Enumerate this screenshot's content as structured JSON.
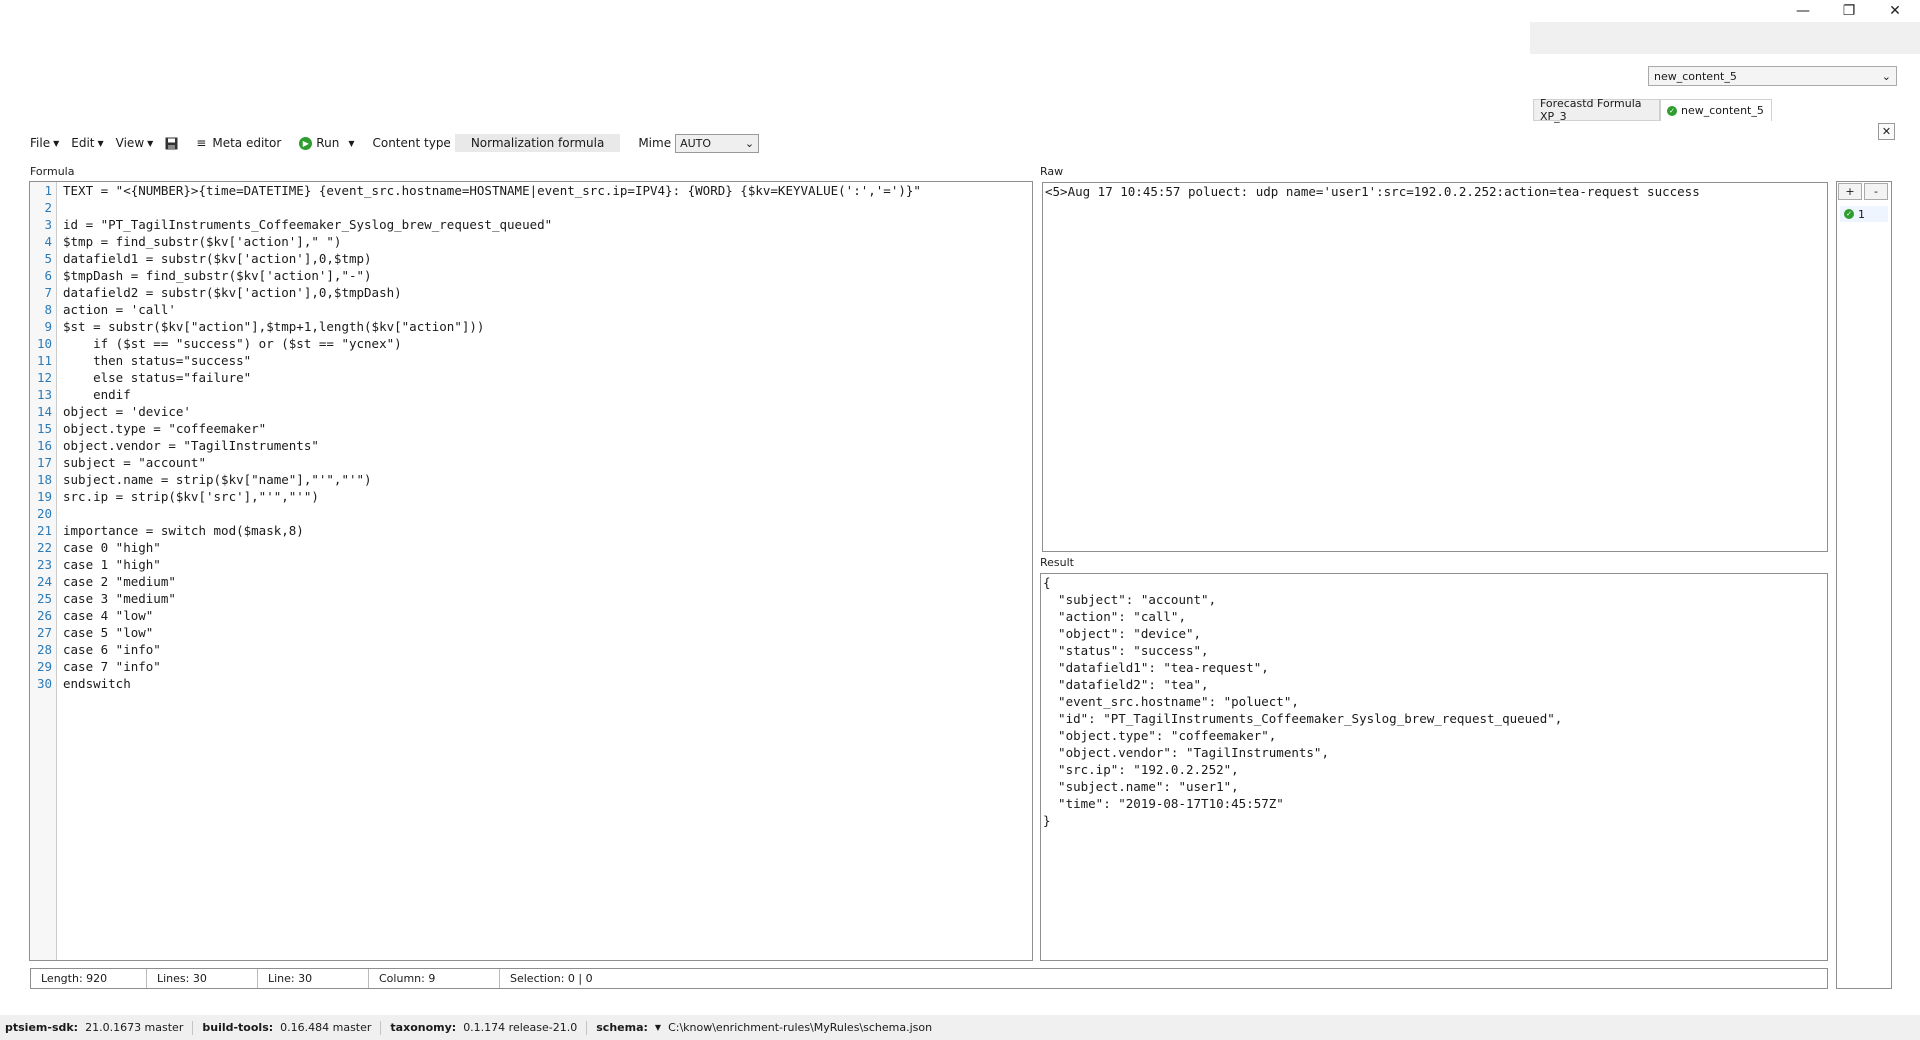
{
  "window": {
    "minimize": "—",
    "restore": "❐",
    "close": "✕"
  },
  "content_selector": {
    "value": "new_content_5"
  },
  "tabs": [
    {
      "label": "Forecastd Formula XP_3",
      "active": false
    },
    {
      "label": "new_content_5",
      "active": true
    }
  ],
  "toolbar": {
    "file": "File",
    "edit": "Edit",
    "view": "View",
    "meta_editor": "Meta editor",
    "run": "Run",
    "content_type_label": "Content type",
    "content_type_value": "Normalization formula",
    "mime_label": "Mime",
    "mime_value": "AUTO"
  },
  "labels": {
    "formula": "Formula",
    "raw": "Raw",
    "result": "Result"
  },
  "formula_lines": [
    "TEXT = \"<{NUMBER}>{time=DATETIME} {event_src.hostname=HOSTNAME|event_src.ip=IPV4}: {WORD} {$kv=KEYVALUE(':','=')}\"",
    "",
    "id = \"PT_TagilInstruments_Coffeemaker_Syslog_brew_request_queued\"",
    "$tmp = find_substr($kv['action'],\" \")",
    "datafield1 = substr($kv['action'],0,$tmp)",
    "$tmpDash = find_substr($kv['action'],\"-\")",
    "datafield2 = substr($kv['action'],0,$tmpDash)",
    "action = 'call'",
    "$st = substr($kv[\"action\"],$tmp+1,length($kv[\"action\"]))",
    "    if ($st == \"success\") or ($st == \"ycnex\")",
    "    then status=\"success\"",
    "    else status=\"failure\"",
    "    endif",
    "object = 'device'",
    "object.type = \"coffeemaker\"",
    "object.vendor = \"TagilInstruments\"",
    "subject = \"account\"",
    "subject.name = strip($kv[\"name\"],\"'\",\"'\")",
    "src.ip = strip($kv['src'],\"'\",\"'\")",
    "",
    "importance = switch mod($mask,8)",
    "case 0 \"high\"",
    "case 1 \"high\"",
    "case 2 \"medium\"",
    "case 3 \"medium\"",
    "case 4 \"low\"",
    "case 5 \"low\"",
    "case 6 \"info\"",
    "case 7 \"info\"",
    "endswitch"
  ],
  "raw_text": "<5>Aug 17 10:45:57 poluect: udp name='user1':src=192.0.2.252:action=tea-request success",
  "result_lines": [
    "{",
    "  \"subject\": \"account\",",
    "  \"action\": \"call\",",
    "  \"object\": \"device\",",
    "  \"status\": \"success\",",
    "  \"datafield1\": \"tea-request\",",
    "  \"datafield2\": \"tea\",",
    "  \"event_src.hostname\": \"poluect\",",
    "  \"id\": \"PT_TagilInstruments_Coffeemaker_Syslog_brew_request_queued\",",
    "  \"object.type\": \"coffeemaker\",",
    "  \"object.vendor\": \"TagilInstruments\",",
    "  \"src.ip\": \"192.0.2.252\",",
    "  \"subject.name\": \"user1\",",
    "  \"time\": \"2019-08-17T10:45:57Z\"",
    "}"
  ],
  "side": {
    "plus": "+",
    "minus": "-",
    "item": "1"
  },
  "status": {
    "length": "Length:   920",
    "lines": "Lines:   30",
    "line": "Line:   30",
    "column": "Column:   9",
    "selection": "Selection:   0 | 0"
  },
  "bottom": {
    "sdk_label": "ptsiem-sdk:",
    "sdk_value": "21.0.1673 master",
    "bt_label": "build-tools:",
    "bt_value": "0.16.484 master",
    "tax_label": "taxonomy:",
    "tax_value": "0.1.174 release-21.0",
    "schema_label": "schema:",
    "schema_value": "C:\\know\\enrichment-rules\\MyRules\\schema.json"
  },
  "icons": [
    "minimize-icon",
    "restore-icon",
    "close-icon",
    "chevron-down-icon",
    "save-icon",
    "list-icon",
    "play-icon",
    "check-icon"
  ],
  "colors": {
    "keyword": "#a000a0",
    "string": "#1a7a1a",
    "line_numbers": "#2b7bb9",
    "ok": "#2e9d2e"
  }
}
